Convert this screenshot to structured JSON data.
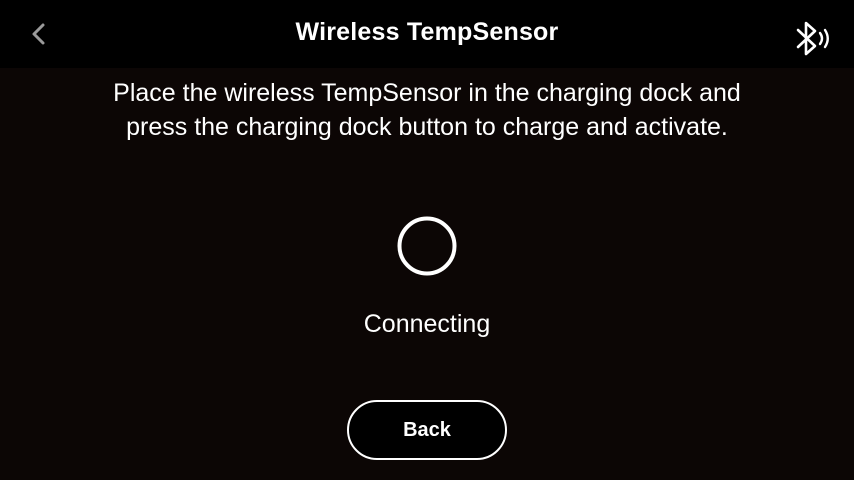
{
  "header": {
    "title": "Wireless TempSensor",
    "back_icon": "chevron-left-icon",
    "status_icon": "bluetooth-signal-icon"
  },
  "main": {
    "instructions_line1": "Place the wireless TempSensor in the charging dock and",
    "instructions_line2": "press the charging dock button to charge and activate.",
    "spinner_icon": "loading-ring-icon",
    "status_text": "Connecting",
    "back_button_label": "Back"
  },
  "colors": {
    "background": "#0c0605",
    "header_background": "#000000",
    "foreground": "#ffffff",
    "chevron": "#9a9a9a"
  }
}
